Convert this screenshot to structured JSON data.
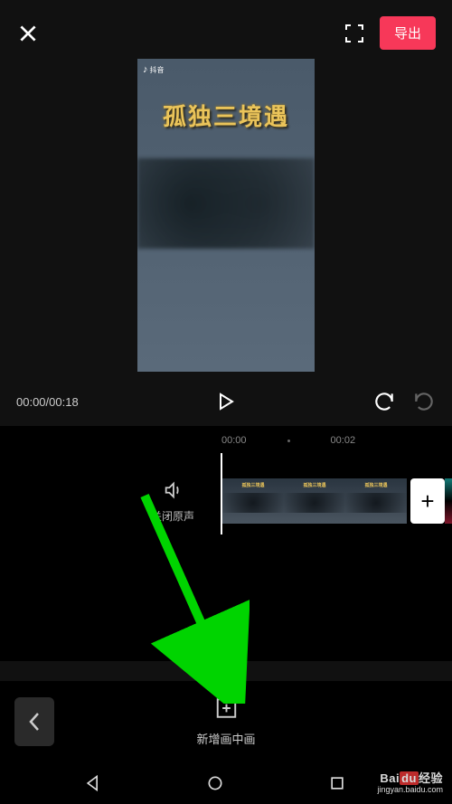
{
  "header": {
    "export_label": "导出",
    "douyin_tag": "抖音"
  },
  "preview": {
    "title": "孤独三境遇"
  },
  "playback": {
    "time_display": "00:00/00:18"
  },
  "timeline": {
    "ruler": [
      "00:00",
      "00:02"
    ],
    "sound_toggle_label": "关闭原声"
  },
  "toolbar": {
    "pip_label": "新增画中画"
  },
  "watermark": {
    "brand_left": "Bai",
    "brand_du": "du",
    "brand_right": "经验",
    "url": "jingyan.baidu.com"
  }
}
